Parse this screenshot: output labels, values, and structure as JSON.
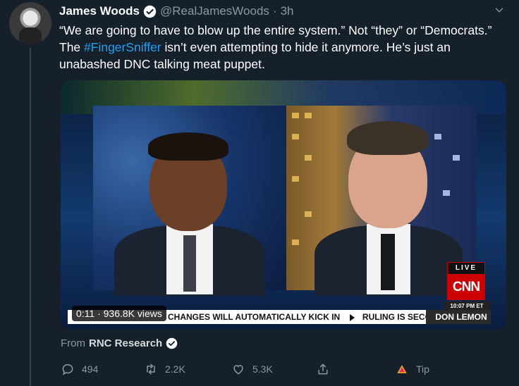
{
  "tweet": {
    "author_name": "James Woods",
    "handle": "@RealJamesWoods",
    "time": "3h",
    "text_part1": "“We are going to have to blow up the entire system.” Not “they” or “Democrats.” The ",
    "hashtag": "#FingerSniffer",
    "text_part2": " isn’t even attempting to hide it anymore. He’s just an unabashed DNC talking meat puppet."
  },
  "video": {
    "views": "0:11 · 936.8K views",
    "live_badge": "LIVE",
    "network": "CNN",
    "clock": "10:07 PM ET",
    "chyron_left": "CHANGES WILL AUTOMATICALLY KICK IN",
    "chyron_right": "RULING IS SECOND FROM FED",
    "nameplate": "DON LEMON"
  },
  "source": {
    "label": "From",
    "name": "RNC Research"
  },
  "actions": {
    "replies": "494",
    "retweets": "2.2K",
    "likes": "5.3K",
    "tip": "Tip"
  },
  "colors": {
    "background": "#15202b",
    "accent": "#1da1f2",
    "muted": "#8899a6"
  }
}
